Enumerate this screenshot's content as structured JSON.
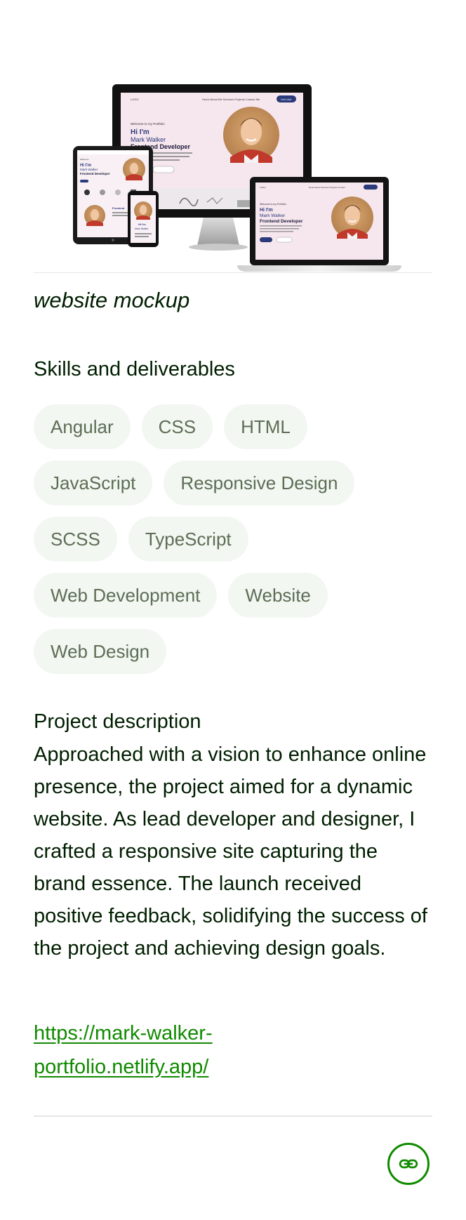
{
  "project": {
    "image_caption": "website mockup",
    "skills_heading": "Skills and deliverables",
    "skills": [
      "Angular",
      "CSS",
      "HTML",
      "JavaScript",
      "Responsive Design",
      "SCSS",
      "TypeScript",
      "Web Development",
      "Website",
      "Web Design"
    ],
    "description_heading": "Project description",
    "description": "Approached with a vision to enhance online presence, the project aimed for a dynamic website. As lead developer and designer, I crafted a responsive site capturing the brand essence. The launch received positive feedback, solidifying the success of the project and achieving design goals.",
    "link": "https://mark-walker-portfolio.netlify.app/"
  },
  "mockup": {
    "screen_greeting": "Welcome to my Portfolio",
    "screen_hi": "Hi I'm",
    "screen_name": "Mark Walker",
    "screen_role": "Frontend Developer"
  },
  "icons": {
    "link_button": "link-icon"
  },
  "colors": {
    "accent_green": "#108a00",
    "chip_bg": "#f2f7f2",
    "chip_text": "#5e6d55",
    "mockup_navy": "#2b3a7a",
    "mockup_pink": "#f6e6ee"
  }
}
